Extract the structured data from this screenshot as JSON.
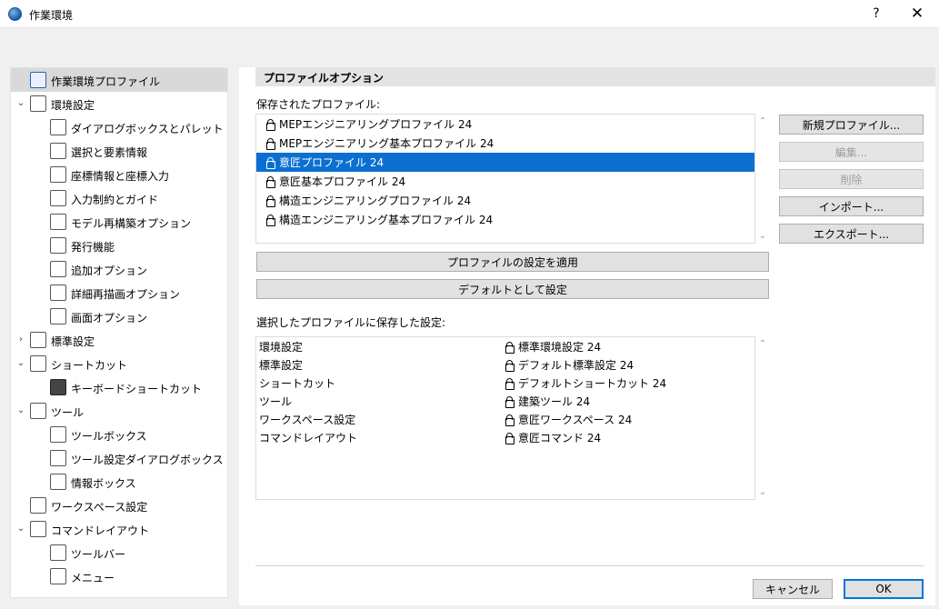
{
  "window": {
    "title": "作業環境",
    "help": "?",
    "close": "✕"
  },
  "tree": {
    "items": [
      {
        "label": "作業環境プロファイル",
        "level": 0,
        "chevron": "",
        "icon": "monitor-profile-icon"
      },
      {
        "label": "環境設定",
        "level": 0,
        "chevron": "⌄",
        "icon": "settings-icon"
      },
      {
        "label": "ダイアログボックスとパレット",
        "level": 1,
        "chevron": "",
        "icon": "dialog-palette-icon"
      },
      {
        "label": "選択と要素情報",
        "level": 1,
        "chevron": "",
        "icon": "selection-info-icon"
      },
      {
        "label": "座標情報と座標入力",
        "level": 1,
        "chevron": "",
        "icon": "xyz-icon"
      },
      {
        "label": "入力制約とガイド",
        "level": 1,
        "chevron": "",
        "icon": "mouse-guide-icon"
      },
      {
        "label": "モデル再構築オプション",
        "level": 1,
        "chevron": "",
        "icon": "model-rebuild-icon"
      },
      {
        "label": "発行機能",
        "level": 1,
        "chevron": "",
        "icon": "publish-icon"
      },
      {
        "label": "追加オプション",
        "level": 1,
        "chevron": "",
        "icon": "sliders-icon"
      },
      {
        "label": "詳細再描画オプション",
        "level": 1,
        "chevron": "",
        "icon": "redraw-icon"
      },
      {
        "label": "画面オプション",
        "level": 1,
        "chevron": "",
        "icon": "screen-icon"
      },
      {
        "label": "標準設定",
        "level": 0,
        "chevron": "›",
        "icon": "standard-settings-icon"
      },
      {
        "label": "ショートカット",
        "level": 0,
        "chevron": "⌄",
        "icon": "shortcut-icon"
      },
      {
        "label": "キーボードショートカット",
        "level": 1,
        "chevron": "",
        "icon": "keyboard-shortcut-icon"
      },
      {
        "label": "ツール",
        "level": 0,
        "chevron": "⌄",
        "icon": "tools-icon"
      },
      {
        "label": "ツールボックス",
        "level": 1,
        "chevron": "",
        "icon": "toolbox-icon"
      },
      {
        "label": "ツール設定ダイアログボックス",
        "level": 1,
        "chevron": "",
        "icon": "tool-settings-icon"
      },
      {
        "label": "情報ボックス",
        "level": 1,
        "chevron": "",
        "icon": "info-box-icon"
      },
      {
        "label": "ワークスペース設定",
        "level": 0,
        "chevron": "",
        "icon": "workspace-icon"
      },
      {
        "label": "コマンドレイアウト",
        "level": 0,
        "chevron": "⌄",
        "icon": "command-layout-icon"
      },
      {
        "label": "ツールバー",
        "level": 1,
        "chevron": "",
        "icon": "toolbar-icon"
      },
      {
        "label": "メニュー",
        "level": 1,
        "chevron": "",
        "icon": "menu-icon"
      }
    ]
  },
  "section": {
    "header": "プロファイルオプション",
    "saved_label": "保存されたプロファイル:",
    "settings_label": "選択したプロファイルに保存した設定:"
  },
  "profiles": [
    "MEPエンジニアリングプロファイル 24",
    "MEPエンジニアリング基本プロファイル 24",
    "意匠プロファイル 24",
    "意匠基本プロファイル 24",
    "構造エンジニアリングプロファイル 24",
    "構造エンジニアリング基本プロファイル 24"
  ],
  "selected_profile_index": 2,
  "side_buttons": {
    "new": "新規プロファイル...",
    "edit": "編集...",
    "delete": "削除",
    "import": "インポート...",
    "export": "エクスポート..."
  },
  "action_buttons": {
    "apply": "プロファイルの設定を適用",
    "default": "デフォルトとして設定"
  },
  "settings": [
    {
      "category": "環境設定",
      "value": "標準環境設定 24"
    },
    {
      "category": "標準設定",
      "value": "デフォルト標準設定 24"
    },
    {
      "category": "ショートカット",
      "value": "デフォルトショートカット 24"
    },
    {
      "category": "ツール",
      "value": "建築ツール 24"
    },
    {
      "category": "ワークスペース設定",
      "value": "意匠ワークスペース 24"
    },
    {
      "category": "コマンドレイアウト",
      "value": "意匠コマンド 24"
    }
  ],
  "footer": {
    "cancel": "キャンセル",
    "ok": "OK"
  },
  "colors": {
    "selection": "#0b6fd1",
    "default_border": "#0078d7"
  }
}
